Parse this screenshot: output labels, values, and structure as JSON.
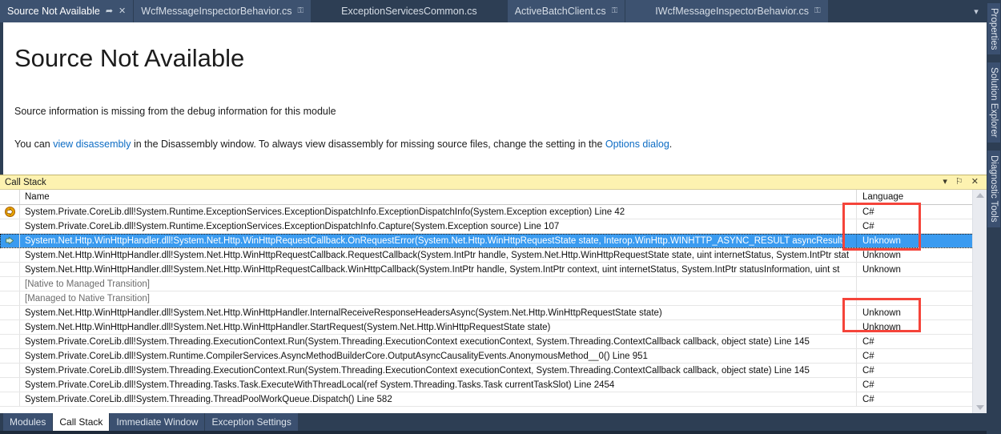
{
  "colors": {
    "chrome": "#2d3e54",
    "tab_active": "#3d5270",
    "panel_title_bg": "#fdf2b0",
    "selection": "#3a9bf0",
    "link": "#0d6cc4",
    "annotation_red": "#f5443a"
  },
  "tabs": [
    {
      "label": "Source Not Available",
      "active": true,
      "pin": "➦",
      "close": "✕",
      "lock": ""
    },
    {
      "label": "WcfMessageInspectorBehavior.cs",
      "active": false,
      "pin": "",
      "close": "",
      "lock": "⚿"
    },
    {
      "label": "ExceptionServicesCommon.cs",
      "active": false,
      "pin": "",
      "close": "",
      "lock": ""
    },
    {
      "label": "ActiveBatchClient.cs",
      "active": false,
      "pin": "",
      "close": "",
      "lock": "⚿"
    },
    {
      "label": "IWcfMessageInspectorBehavior.cs",
      "active": false,
      "pin": "",
      "close": "",
      "lock": "⚿"
    }
  ],
  "tab_overflow_icon": "▾",
  "document": {
    "title": "Source Not Available",
    "subtitle": "Source information is missing from the debug information for this module",
    "paragraph": {
      "before_link1": "You can ",
      "link1": "view disassembly",
      "between": " in the Disassembly window. To always view disassembly for missing source files, change the setting in the ",
      "link2": "Options dialog",
      "after": "."
    }
  },
  "call_stack_panel": {
    "title": "Call Stack",
    "tools": {
      "dropdown": "▾",
      "pin": "⚐",
      "close": "✕"
    },
    "columns": {
      "name": "Name",
      "language": "Language"
    },
    "rows": [
      {
        "icon": "current-statement-arrow",
        "name": "System.Private.CoreLib.dll!System.Runtime.ExceptionServices.ExceptionDispatchInfo.ExceptionDispatchInfo(System.Exception exception) Line 42",
        "language": "C#",
        "selected": false,
        "dim": false
      },
      {
        "icon": "",
        "name": "System.Private.CoreLib.dll!System.Runtime.ExceptionServices.ExceptionDispatchInfo.Capture(System.Exception source) Line 107",
        "language": "C#",
        "selected": false,
        "dim": false
      },
      {
        "icon": "stack-frame-arrow",
        "name": "System.Net.Http.WinHttpHandler.dll!System.Net.Http.WinHttpRequestCallback.OnRequestError(System.Net.Http.WinHttpRequestState state, Interop.WinHttp.WINHTTP_ASYNC_RESULT asyncResult)",
        "language": "Unknown",
        "selected": true,
        "dim": false
      },
      {
        "icon": "",
        "name": "System.Net.Http.WinHttpHandler.dll!System.Net.Http.WinHttpRequestCallback.RequestCallback(System.IntPtr handle, System.Net.Http.WinHttpRequestState state, uint internetStatus, System.IntPtr stat",
        "language": "Unknown",
        "selected": false,
        "dim": false
      },
      {
        "icon": "",
        "name": "System.Net.Http.WinHttpHandler.dll!System.Net.Http.WinHttpRequestCallback.WinHttpCallback(System.IntPtr handle, System.IntPtr context, uint internetStatus, System.IntPtr statusInformation, uint st",
        "language": "Unknown",
        "selected": false,
        "dim": false
      },
      {
        "icon": "",
        "name": "[Native to Managed Transition]",
        "language": "",
        "selected": false,
        "dim": true
      },
      {
        "icon": "",
        "name": "[Managed to Native Transition]",
        "language": "",
        "selected": false,
        "dim": true
      },
      {
        "icon": "",
        "name": "System.Net.Http.WinHttpHandler.dll!System.Net.Http.WinHttpHandler.InternalReceiveResponseHeadersAsync(System.Net.Http.WinHttpRequestState state)",
        "language": "Unknown",
        "selected": false,
        "dim": false
      },
      {
        "icon": "",
        "name": "System.Net.Http.WinHttpHandler.dll!System.Net.Http.WinHttpHandler.StartRequest(System.Net.Http.WinHttpRequestState state)",
        "language": "Unknown",
        "selected": false,
        "dim": false
      },
      {
        "icon": "",
        "name": "System.Private.CoreLib.dll!System.Threading.ExecutionContext.Run(System.Threading.ExecutionContext executionContext, System.Threading.ContextCallback callback, object state) Line 145",
        "language": "C#",
        "selected": false,
        "dim": false
      },
      {
        "icon": "",
        "name": "System.Private.CoreLib.dll!System.Runtime.CompilerServices.AsyncMethodBuilderCore.OutputAsyncCausalityEvents.AnonymousMethod__0() Line 951",
        "language": "C#",
        "selected": false,
        "dim": false
      },
      {
        "icon": "",
        "name": "System.Private.CoreLib.dll!System.Threading.ExecutionContext.Run(System.Threading.ExecutionContext executionContext, System.Threading.ContextCallback callback, object state) Line 145",
        "language": "C#",
        "selected": false,
        "dim": false
      },
      {
        "icon": "",
        "name": "System.Private.CoreLib.dll!System.Threading.Tasks.Task.ExecuteWithThreadLocal(ref System.Threading.Tasks.Task currentTaskSlot) Line 2454",
        "language": "C#",
        "selected": false,
        "dim": false
      },
      {
        "icon": "",
        "name": "System.Private.CoreLib.dll!System.Threading.ThreadPoolWorkQueue.Dispatch() Line 582",
        "language": "C#",
        "selected": false,
        "dim": false
      }
    ]
  },
  "bottom_tabs": [
    {
      "label": "Modules",
      "active": false
    },
    {
      "label": "Call Stack",
      "active": true
    },
    {
      "label": "Immediate Window",
      "active": false
    },
    {
      "label": "Exception Settings",
      "active": false
    }
  ],
  "right_dock": [
    {
      "label": "Properties"
    },
    {
      "label": "Solution Explorer"
    },
    {
      "label": "Diagnostic Tools"
    }
  ],
  "annotations": [
    {
      "name": "unknown-language-highlight-upper"
    },
    {
      "name": "unknown-language-highlight-lower"
    }
  ]
}
